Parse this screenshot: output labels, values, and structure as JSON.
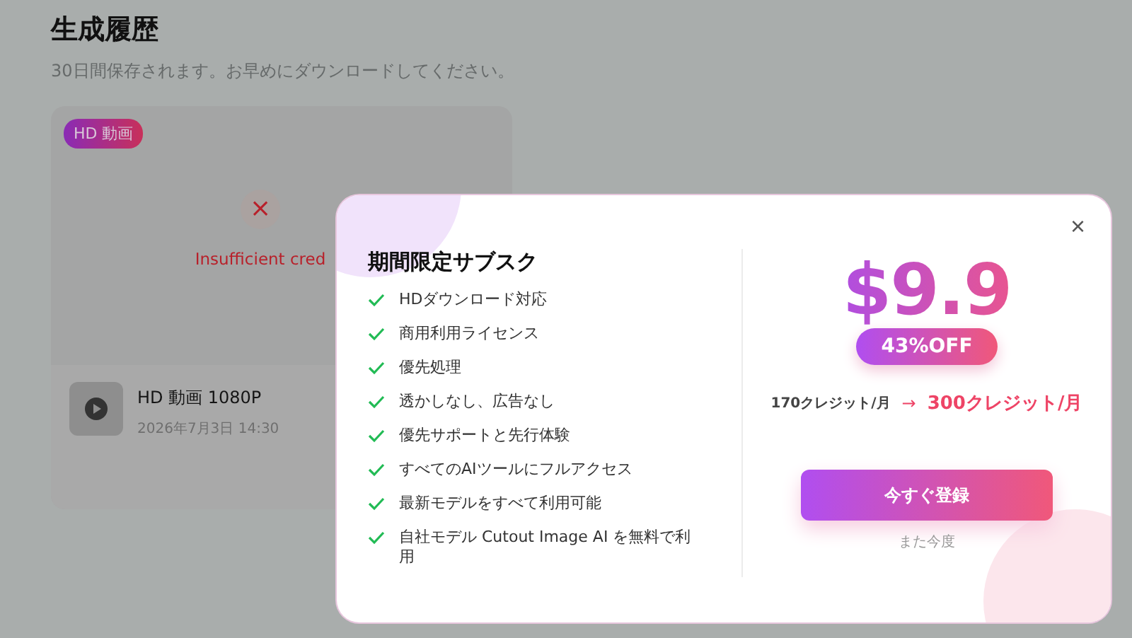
{
  "page": {
    "title": "生成履歴",
    "subtitle": "30日間保存されます。お早めにダウンロードしてください。"
  },
  "history_card": {
    "badge": "HD 動画",
    "error_icon": "×",
    "error": "Insufficient cred",
    "item_title": "HD 動画 1080P",
    "item_date": "2026年7月3日 14:30"
  },
  "modal": {
    "close": "×",
    "title": "期間限定サブスク",
    "features": [
      "HDダウンロード対応",
      "商用利用ライセンス",
      "優先処理",
      "透かしなし、広告なし",
      "優先サポートと先行体験",
      "すべてのAIツールにフルアクセス",
      "最新モデルをすべて利用可能",
      "自社モデル Cutout Image AI を無料で利用"
    ],
    "price": "$9.9",
    "discount": "43%OFF",
    "old_credits": "170クレジット/月",
    "arrow": "→",
    "new_credits": "300クレジット/月",
    "cta": "今すぐ登録",
    "later": "また今度"
  }
}
